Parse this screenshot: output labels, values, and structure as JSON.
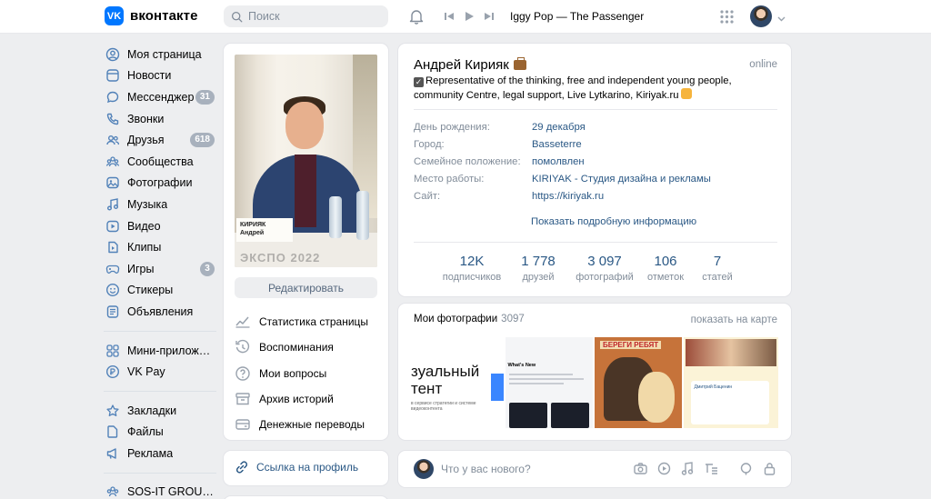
{
  "header": {
    "logo_mark": "VK",
    "logo_text": "вконтакте",
    "search_placeholder": "Поиск",
    "now_playing": "Iggy Pop — The Passenger"
  },
  "nav": {
    "items": [
      {
        "label": "Моя страница",
        "icon": "user-circle-icon"
      },
      {
        "label": "Новости",
        "icon": "newsfeed-icon"
      },
      {
        "label": "Мессенджер",
        "icon": "message-icon",
        "badge": "31"
      },
      {
        "label": "Звонки",
        "icon": "phone-icon"
      },
      {
        "label": "Друзья",
        "icon": "friends-icon",
        "badge": "618"
      },
      {
        "label": "Сообщества",
        "icon": "communities-icon"
      },
      {
        "label": "Фотографии",
        "icon": "photo-icon"
      },
      {
        "label": "Музыка",
        "icon": "music-icon"
      },
      {
        "label": "Видео",
        "icon": "video-icon"
      },
      {
        "label": "Клипы",
        "icon": "clips-icon"
      },
      {
        "label": "Игры",
        "icon": "gamepad-icon",
        "badge": "3"
      },
      {
        "label": "Стикеры",
        "icon": "smile-icon"
      },
      {
        "label": "Объявления",
        "icon": "ads-icon"
      }
    ],
    "items2": [
      {
        "label": "Мини-приложения",
        "icon": "apps-icon"
      },
      {
        "label": "VK Pay",
        "icon": "vkpay-icon"
      }
    ],
    "items3": [
      {
        "label": "Закладки",
        "icon": "star-icon"
      },
      {
        "label": "Файлы",
        "icon": "file-icon"
      },
      {
        "label": "Реклама",
        "icon": "megaphone-icon"
      }
    ],
    "items4": [
      {
        "label": "SOS-IT GROUP | ИТ...",
        "icon": "group-icon"
      }
    ]
  },
  "photo_card": {
    "photo_sign": "КИРИЯК Андрей",
    "photo_bottom": "ЭКСПО 2022",
    "edit_label": "Редактировать",
    "links": [
      {
        "label": "Статистика страницы",
        "icon": "chart-icon"
      },
      {
        "label": "Воспоминания",
        "icon": "history-icon"
      },
      {
        "label": "Мои вопросы",
        "icon": "question-icon"
      },
      {
        "label": "Архив историй",
        "icon": "archive-icon"
      },
      {
        "label": "Денежные переводы",
        "icon": "money-icon"
      }
    ]
  },
  "profile_link": {
    "label": "Ссылка на профиль"
  },
  "profile": {
    "name": "Андрей Кирияк",
    "online": "online",
    "status": "Representative of the thinking, free and independent young people, community Centre, legal support, Live Lytkarino, Kiriyak.ru",
    "info": [
      {
        "key": "День рождения:",
        "value": "29 декабря"
      },
      {
        "key": "Город:",
        "value": "Basseterre"
      },
      {
        "key": "Семейное положение:",
        "value": "помолвлен"
      },
      {
        "key": "Место работы:",
        "value": "KIRIYAK - Студия дизайна и рекламы"
      },
      {
        "key": "Сайт:",
        "value": "https://kiriyak.ru"
      }
    ],
    "more_info": "Показать подробную информацию",
    "stats": [
      {
        "n": "12K",
        "l": "подписчиков"
      },
      {
        "n": "1 778",
        "l": "друзей"
      },
      {
        "n": "3 097",
        "l": "фотографий"
      },
      {
        "n": "106",
        "l": "отметок"
      },
      {
        "n": "7",
        "l": "статей"
      }
    ]
  },
  "photos": {
    "title": "Мои фотографии",
    "count": "3097",
    "map_link": "показать на карте",
    "t1_big": "зуальный\nтент",
    "t1_small": "в сервисе стратегии и системе видеоконтента",
    "t2_header": "What's New",
    "t3_title": "БЕРЕГИ РЕБЯТ",
    "t4_who": "Дмитрий Баценин"
  },
  "post": {
    "placeholder": "Что у вас нового?"
  }
}
